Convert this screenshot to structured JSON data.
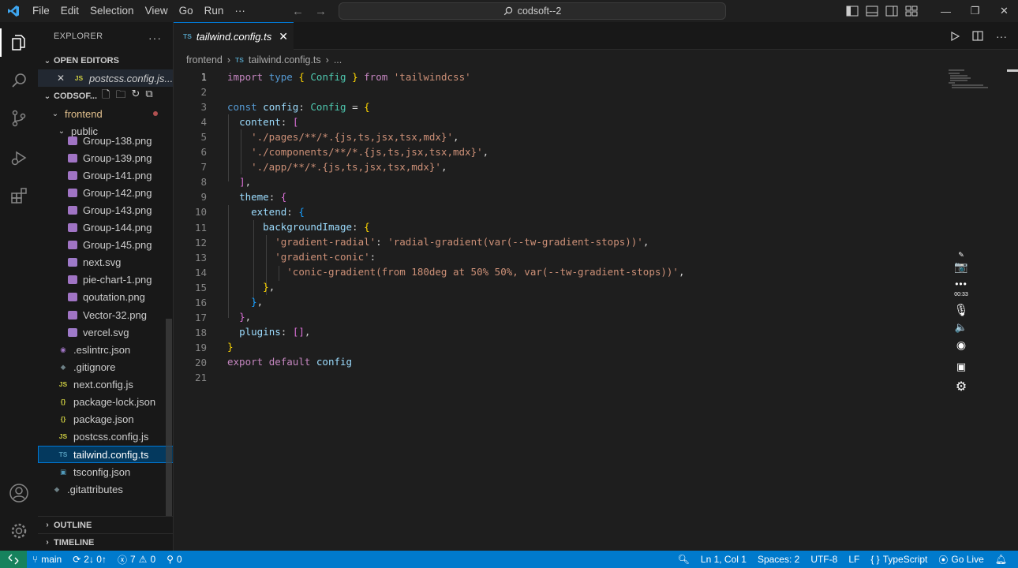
{
  "titlebar": {
    "menu": [
      "File",
      "Edit",
      "Selection",
      "View",
      "Go",
      "Run",
      "···"
    ],
    "search_text": "codsoft--2"
  },
  "sidebar": {
    "title": "EXPLORER",
    "open_editors_label": "OPEN EDITORS",
    "open_editor_file": "postcss.config.js...",
    "workspace_label": "CODSOF...",
    "folder_frontend": "frontend",
    "folder_public": "public",
    "public_files": [
      "Group-138.png",
      "Group-139.png",
      "Group-141.png",
      "Group-142.png",
      "Group-143.png",
      "Group-144.png",
      "Group-145.png",
      "next.svg",
      "pie-chart-1.png",
      "qoutation.png",
      "Vector-32.png",
      "vercel.svg"
    ],
    "root_files": [
      ".eslintrc.json",
      ".gitignore",
      "next.config.js",
      "package-lock.json",
      "package.json",
      "postcss.config.js",
      "tailwind.config.ts",
      "tsconfig.json"
    ],
    "gitattributes": ".gitattributes",
    "outline_label": "OUTLINE",
    "timeline_label": "TIMELINE"
  },
  "editor": {
    "tab_label": "tailwind.config.ts",
    "tab_lang": "TS",
    "breadcrumb_folder": "frontend",
    "breadcrumb_file": "tailwind.config.ts",
    "breadcrumb_more": "...",
    "line_count": 21
  },
  "statusbar": {
    "branch": "main",
    "sync": "2↓ 0↑",
    "errors": "7",
    "warnings": "0",
    "ports": "0",
    "position": "Ln 1, Col 1",
    "spaces": "Spaces: 2",
    "encoding": "UTF-8",
    "eol": "LF",
    "language": "TypeScript",
    "golive": "Go Live"
  },
  "recorder": {
    "timer": "00:33"
  },
  "colors": {
    "accent": "#007acc",
    "selection": "#04395e",
    "remote": "#16825d"
  }
}
